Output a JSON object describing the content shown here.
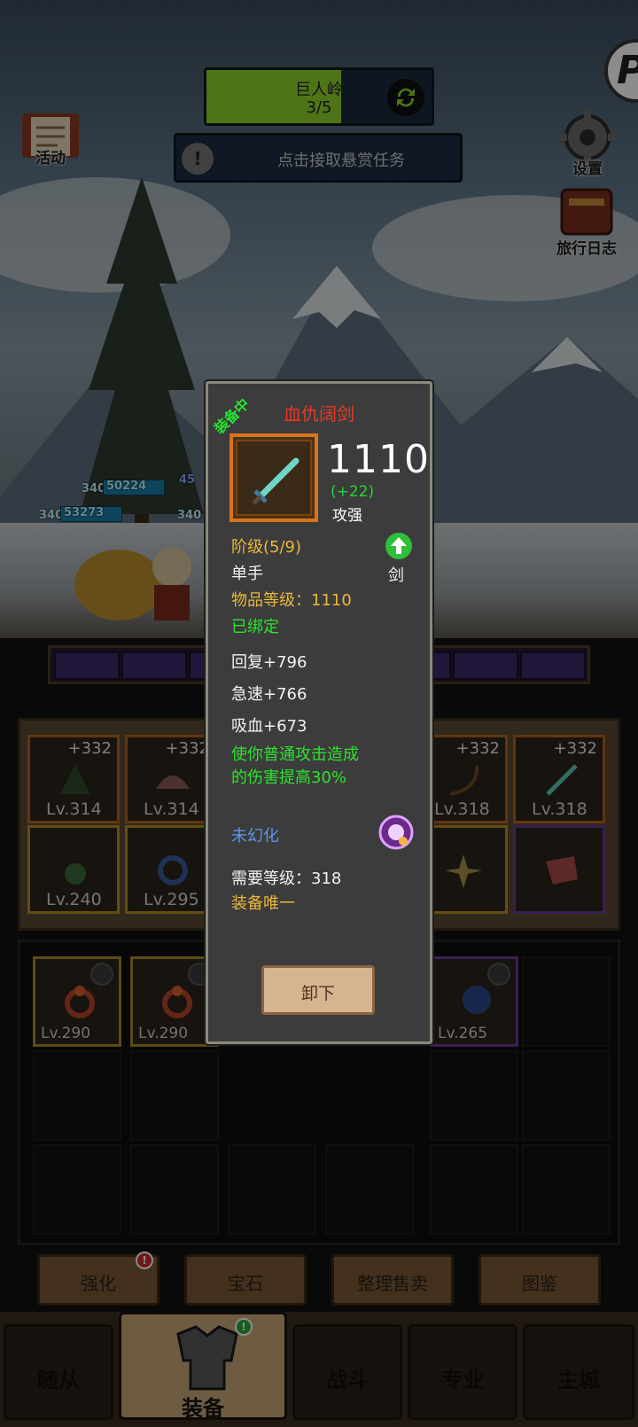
{
  "hud": {
    "area_name": "巨人岭",
    "area_progress": "3/5",
    "area_progress_fraction": 0.6,
    "quest_prompt": "点击接取悬赏任务",
    "left_icon_label": "活动",
    "settings_label": "设置",
    "journal_label": "旅行日志"
  },
  "battle": {
    "unit_levels": [
      "340",
      "340",
      "340"
    ],
    "hp_values": [
      "50224",
      "53273"
    ],
    "stage_badge": "45"
  },
  "equipment": {
    "slots": [
      {
        "plus": "+332",
        "level": "Lv.314"
      },
      {
        "plus": "+332",
        "level": "Lv.314"
      },
      {
        "plus": "+332",
        "level": "Lv.318"
      },
      {
        "plus": "+332",
        "level": "Lv.318"
      },
      {
        "level": "Lv.240"
      },
      {
        "level": "Lv.295"
      },
      {
        "level": ""
      },
      {
        "level": ""
      }
    ]
  },
  "bag": {
    "items": [
      {
        "level": "Lv.290"
      },
      {
        "level": "Lv.290"
      },
      {
        "level": "Lv.265"
      }
    ]
  },
  "actions": {
    "enhance": "强化",
    "gem": "宝石",
    "sort_sell": "整理售卖",
    "codex": "图鉴",
    "enhance_badge": "!",
    "equip_badge": "!"
  },
  "nav": {
    "followers": "随从",
    "equipment": "装备",
    "battle": "战斗",
    "profession": "专业",
    "main_city": "主城"
  },
  "tooltip": {
    "equipped_tag": "装备中",
    "item_name": "血仇阔剑",
    "power": "1110",
    "power_delta": "(+22)",
    "power_status": "攻强",
    "tier": "阶级(5/9)",
    "hand_type": "单手",
    "weapon_type": "剑",
    "item_level": "物品等级：1110",
    "bound": "已绑定",
    "stats": [
      "回复+796",
      "急速+766",
      "吸血+673"
    ],
    "effect_line1": "使你普通攻击造成",
    "effect_line2": "的伤害提高30%",
    "transmog": "未幻化",
    "required_level": "需要等级：318",
    "unique": "装备唯一",
    "unequip_button": "卸下"
  },
  "colors": {
    "item_name": "#e83a28",
    "gold_text": "#e8b83a",
    "green_text": "#2ee22e",
    "blue_text": "#5d95e6",
    "rarity_orange": "#d9731c"
  },
  "icons": [
    "refresh-icon",
    "alert-icon",
    "activity-scroll-icon",
    "gear-icon",
    "journal-book-icon",
    "upgrade-arrow-icon",
    "transmog-orb-icon",
    "lock-icon",
    "sword-icon",
    "armor-icon"
  ]
}
